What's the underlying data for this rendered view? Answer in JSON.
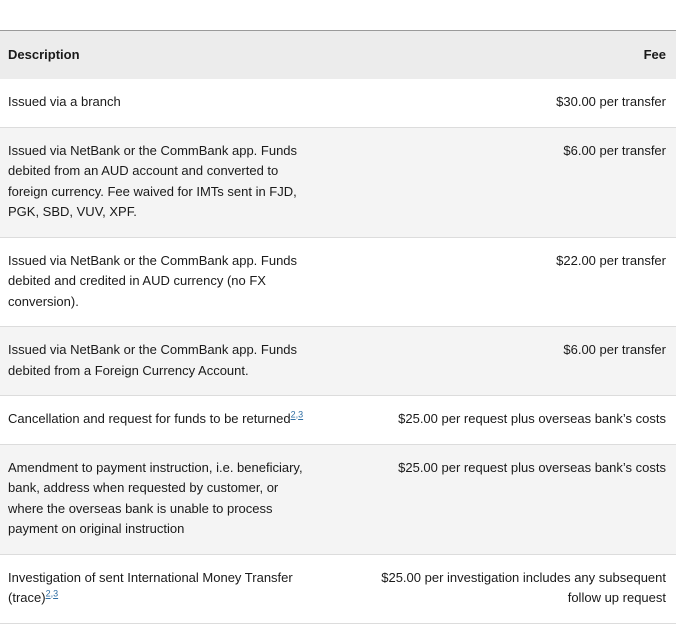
{
  "table": {
    "header": {
      "description": "Description",
      "fee": "Fee"
    },
    "rows": [
      {
        "description": "Issued via a branch",
        "fee": "$30.00 per transfer",
        "footnotes": ""
      },
      {
        "description": "Issued via NetBank or the CommBank app. Funds debited from an AUD account and converted to foreign currency. Fee waived for IMTs sent in FJD, PGK, SBD, VUV, XPF.",
        "fee": "$6.00 per transfer",
        "footnotes": ""
      },
      {
        "description": "Issued via NetBank or the CommBank app. Funds debited and credited in AUD currency (no FX conversion).",
        "fee": "$22.00 per transfer",
        "footnotes": ""
      },
      {
        "description": "Issued via NetBank or the CommBank app. Funds debited from a Foreign Currency Account.",
        "fee": "$6.00 per transfer",
        "footnotes": ""
      },
      {
        "description": "Cancellation and request for funds to be returned",
        "fee": "$25.00 per request plus overseas bank’s costs",
        "footnotes": [
          "2",
          "3"
        ]
      },
      {
        "description": "Amendment to payment instruction, i.e. beneficiary, bank, address when requested by customer, or where the overseas bank is unable to process payment on original instruction",
        "fee": "$25.00 per request plus overseas bank’s costs",
        "footnotes": ""
      },
      {
        "description": "Investigation of sent International Money Transfer (trace)",
        "fee": "$25.00 per investigation includes any subsequent follow up request",
        "footnotes": [
          "2",
          "3"
        ]
      }
    ]
  }
}
